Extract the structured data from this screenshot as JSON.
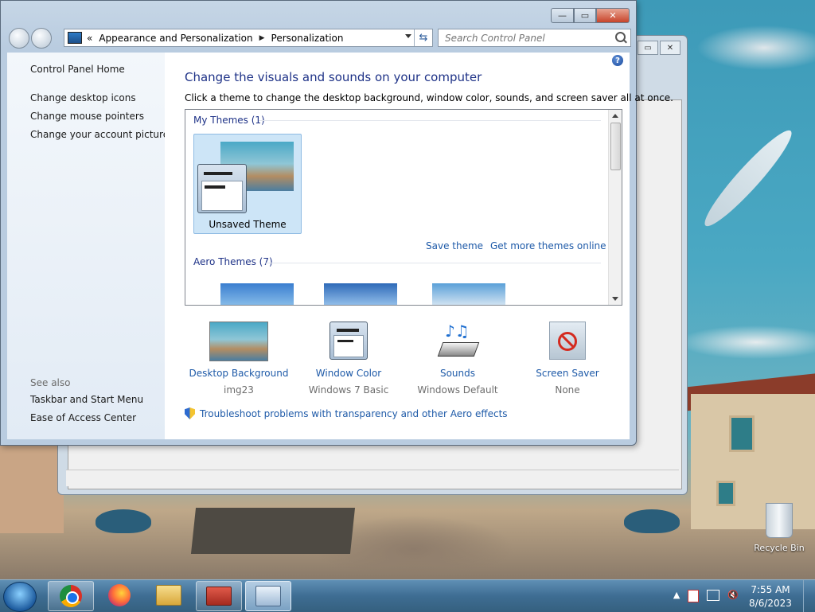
{
  "window": {
    "breadcrumb_prefix": "«",
    "breadcrumb": [
      "Appearance and Personalization",
      "Personalization"
    ],
    "search_placeholder": "Search Control Panel"
  },
  "sidebar": {
    "home": "Control Panel Home",
    "links": [
      "Change desktop icons",
      "Change mouse pointers",
      "Change your account picture"
    ],
    "see_also_label": "See also",
    "see_also": [
      "Taskbar and Start Menu",
      "Ease of Access Center"
    ]
  },
  "main": {
    "title": "Change the visuals and sounds on your computer",
    "description": "Click a theme to change the desktop background, window color, sounds, and screen saver all at once.",
    "my_themes_header": "My Themes (1)",
    "selected_theme": "Unsaved Theme",
    "save_theme": "Save theme",
    "get_more_themes": "Get more themes online",
    "aero_themes_header": "Aero Themes (7)"
  },
  "options": [
    {
      "label": "Desktop Background",
      "value": "img23",
      "icon": "desktop-background-icon"
    },
    {
      "label": "Window Color",
      "value": "Windows 7 Basic",
      "icon": "window-color-icon"
    },
    {
      "label": "Sounds",
      "value": "Windows Default",
      "icon": "sounds-icon"
    },
    {
      "label": "Screen Saver",
      "value": "None",
      "icon": "screen-saver-icon"
    }
  ],
  "troubleshoot_link": "Troubleshoot problems with transparency and other Aero effects",
  "desktop": {
    "recycle_bin": "Recycle Bin"
  },
  "taskbar": {
    "apps": [
      "chrome-icon",
      "firefox-icon",
      "file-explorer-icon",
      "toolbox-icon",
      "control-panel-icon"
    ],
    "time": "7:55 AM",
    "date": "8/6/2023"
  },
  "colors": {
    "link": "#1e5aa8",
    "heading": "#1e3287",
    "selection": "#cde5f7"
  }
}
